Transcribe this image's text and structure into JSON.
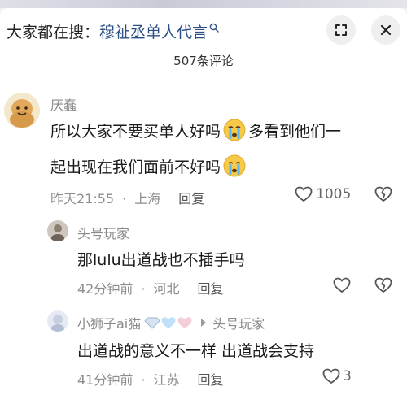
{
  "search": {
    "prefix": "大家都在搜：",
    "query": "穆祉丞单人代言"
  },
  "header": {
    "comment_count": "507条评论"
  },
  "comments": [
    {
      "author": "厌蠢",
      "line1": "所以大家不要买单人好吗",
      "line1b": "多看到他们一",
      "line2": "起出现在我们面前不好吗",
      "time": "昨天21:55",
      "location": "上海",
      "reply": "回复",
      "likes": "1005"
    },
    {
      "author": "头号玩家",
      "text": "那lulu出道战也不插手吗",
      "time": "42分钟前",
      "location": "河北",
      "reply": "回复"
    },
    {
      "author": "小狮子ai猫",
      "reply_to": "头号玩家",
      "text": "出道战的意义不一样 出道战会支持",
      "time": "41分钟前",
      "location": "江苏",
      "reply": "回复",
      "likes": "3"
    }
  ],
  "colors": {
    "query_blue": "#2c4f86",
    "meta_gray": "#8d8d8d",
    "name_gray": "#8a8a8a"
  },
  "icons": [
    "search-icon",
    "expand-icon",
    "close-icon",
    "heart-icon",
    "dislike-icon",
    "crying-emoji",
    "arrow-right-icon"
  ]
}
